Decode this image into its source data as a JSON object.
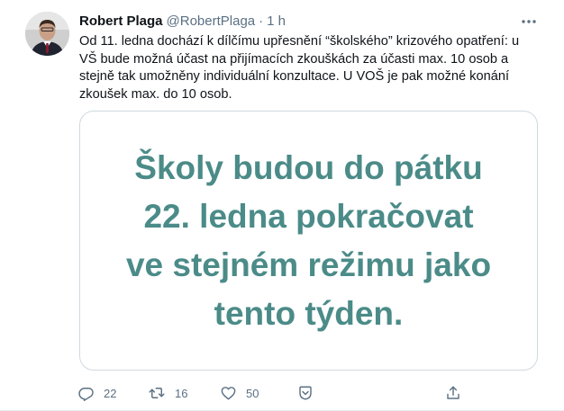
{
  "tweet": {
    "author_name": "Robert Plaga",
    "author_handle": "@RobertPlaga",
    "separator": "·",
    "time": "1 h",
    "text": "Od 11. ledna dochází k dílčímu upřesnění “školského” krizového opatření: u VŠ bude možná účast na přijímacích zkouškách za účasti max. 10 osob a stejně tak umožněny individuální konzultace. U VOŠ je pak možné konání zkoušek max. do 10 osob.",
    "image_lines": [
      "Školy budou do pátku",
      "22. ledna pokračovat",
      "ve stejném režimu jako",
      "tento týden."
    ],
    "image_text_color": "#4b8b88"
  },
  "actions": {
    "reply_count": "22",
    "retweet_count": "16",
    "like_count": "50",
    "icons": [
      "reply-icon",
      "retweet-icon",
      "like-icon",
      "save-icon",
      "share-icon"
    ]
  }
}
